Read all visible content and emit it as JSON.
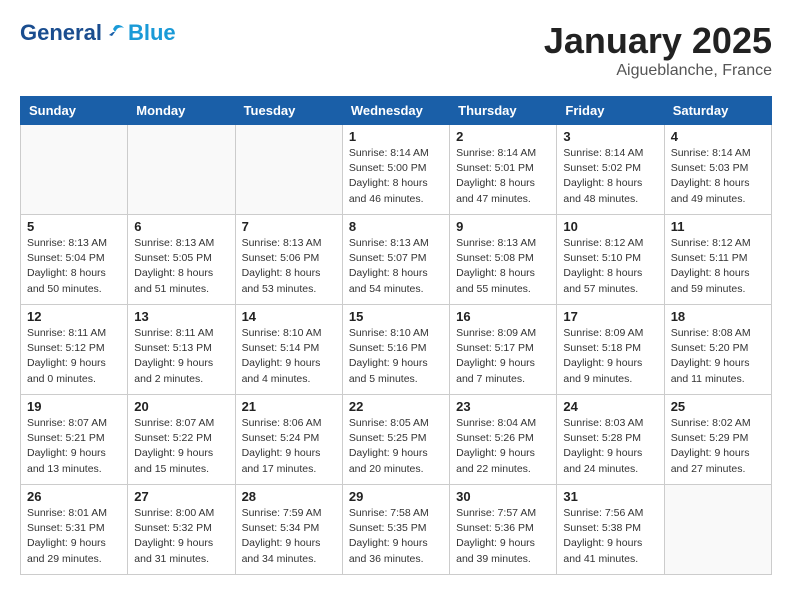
{
  "logo": {
    "general": "General",
    "blue": "Blue"
  },
  "header": {
    "month": "January 2025",
    "location": "Aigueblanche, France"
  },
  "weekdays": [
    "Sunday",
    "Monday",
    "Tuesday",
    "Wednesday",
    "Thursday",
    "Friday",
    "Saturday"
  ],
  "weeks": [
    [
      {
        "day": "",
        "info": ""
      },
      {
        "day": "",
        "info": ""
      },
      {
        "day": "",
        "info": ""
      },
      {
        "day": "1",
        "info": "Sunrise: 8:14 AM\nSunset: 5:00 PM\nDaylight: 8 hours\nand 46 minutes."
      },
      {
        "day": "2",
        "info": "Sunrise: 8:14 AM\nSunset: 5:01 PM\nDaylight: 8 hours\nand 47 minutes."
      },
      {
        "day": "3",
        "info": "Sunrise: 8:14 AM\nSunset: 5:02 PM\nDaylight: 8 hours\nand 48 minutes."
      },
      {
        "day": "4",
        "info": "Sunrise: 8:14 AM\nSunset: 5:03 PM\nDaylight: 8 hours\nand 49 minutes."
      }
    ],
    [
      {
        "day": "5",
        "info": "Sunrise: 8:13 AM\nSunset: 5:04 PM\nDaylight: 8 hours\nand 50 minutes."
      },
      {
        "day": "6",
        "info": "Sunrise: 8:13 AM\nSunset: 5:05 PM\nDaylight: 8 hours\nand 51 minutes."
      },
      {
        "day": "7",
        "info": "Sunrise: 8:13 AM\nSunset: 5:06 PM\nDaylight: 8 hours\nand 53 minutes."
      },
      {
        "day": "8",
        "info": "Sunrise: 8:13 AM\nSunset: 5:07 PM\nDaylight: 8 hours\nand 54 minutes."
      },
      {
        "day": "9",
        "info": "Sunrise: 8:13 AM\nSunset: 5:08 PM\nDaylight: 8 hours\nand 55 minutes."
      },
      {
        "day": "10",
        "info": "Sunrise: 8:12 AM\nSunset: 5:10 PM\nDaylight: 8 hours\nand 57 minutes."
      },
      {
        "day": "11",
        "info": "Sunrise: 8:12 AM\nSunset: 5:11 PM\nDaylight: 8 hours\nand 59 minutes."
      }
    ],
    [
      {
        "day": "12",
        "info": "Sunrise: 8:11 AM\nSunset: 5:12 PM\nDaylight: 9 hours\nand 0 minutes."
      },
      {
        "day": "13",
        "info": "Sunrise: 8:11 AM\nSunset: 5:13 PM\nDaylight: 9 hours\nand 2 minutes."
      },
      {
        "day": "14",
        "info": "Sunrise: 8:10 AM\nSunset: 5:14 PM\nDaylight: 9 hours\nand 4 minutes."
      },
      {
        "day": "15",
        "info": "Sunrise: 8:10 AM\nSunset: 5:16 PM\nDaylight: 9 hours\nand 5 minutes."
      },
      {
        "day": "16",
        "info": "Sunrise: 8:09 AM\nSunset: 5:17 PM\nDaylight: 9 hours\nand 7 minutes."
      },
      {
        "day": "17",
        "info": "Sunrise: 8:09 AM\nSunset: 5:18 PM\nDaylight: 9 hours\nand 9 minutes."
      },
      {
        "day": "18",
        "info": "Sunrise: 8:08 AM\nSunset: 5:20 PM\nDaylight: 9 hours\nand 11 minutes."
      }
    ],
    [
      {
        "day": "19",
        "info": "Sunrise: 8:07 AM\nSunset: 5:21 PM\nDaylight: 9 hours\nand 13 minutes."
      },
      {
        "day": "20",
        "info": "Sunrise: 8:07 AM\nSunset: 5:22 PM\nDaylight: 9 hours\nand 15 minutes."
      },
      {
        "day": "21",
        "info": "Sunrise: 8:06 AM\nSunset: 5:24 PM\nDaylight: 9 hours\nand 17 minutes."
      },
      {
        "day": "22",
        "info": "Sunrise: 8:05 AM\nSunset: 5:25 PM\nDaylight: 9 hours\nand 20 minutes."
      },
      {
        "day": "23",
        "info": "Sunrise: 8:04 AM\nSunset: 5:26 PM\nDaylight: 9 hours\nand 22 minutes."
      },
      {
        "day": "24",
        "info": "Sunrise: 8:03 AM\nSunset: 5:28 PM\nDaylight: 9 hours\nand 24 minutes."
      },
      {
        "day": "25",
        "info": "Sunrise: 8:02 AM\nSunset: 5:29 PM\nDaylight: 9 hours\nand 27 minutes."
      }
    ],
    [
      {
        "day": "26",
        "info": "Sunrise: 8:01 AM\nSunset: 5:31 PM\nDaylight: 9 hours\nand 29 minutes."
      },
      {
        "day": "27",
        "info": "Sunrise: 8:00 AM\nSunset: 5:32 PM\nDaylight: 9 hours\nand 31 minutes."
      },
      {
        "day": "28",
        "info": "Sunrise: 7:59 AM\nSunset: 5:34 PM\nDaylight: 9 hours\nand 34 minutes."
      },
      {
        "day": "29",
        "info": "Sunrise: 7:58 AM\nSunset: 5:35 PM\nDaylight: 9 hours\nand 36 minutes."
      },
      {
        "day": "30",
        "info": "Sunrise: 7:57 AM\nSunset: 5:36 PM\nDaylight: 9 hours\nand 39 minutes."
      },
      {
        "day": "31",
        "info": "Sunrise: 7:56 AM\nSunset: 5:38 PM\nDaylight: 9 hours\nand 41 minutes."
      },
      {
        "day": "",
        "info": ""
      }
    ]
  ]
}
